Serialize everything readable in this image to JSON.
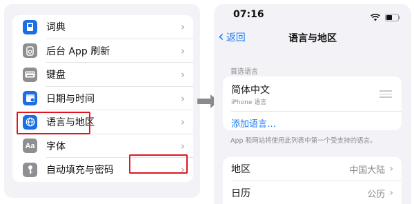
{
  "left_menu": {
    "items": [
      {
        "label": "词典",
        "icon": "book-icon"
      },
      {
        "label": "后台 App 刷新",
        "icon": "refresh-icon"
      },
      {
        "label": "键盘",
        "icon": "keyboard-icon"
      },
      {
        "label": "日期与时间",
        "icon": "calendar-clock-icon"
      },
      {
        "label": "语言与地区",
        "icon": "globe-icon"
      },
      {
        "label": "字体",
        "icon": "font-icon"
      },
      {
        "label": "自动填充与密码",
        "icon": "key-icon"
      }
    ]
  },
  "status_bar": {
    "time": "07:16"
  },
  "nav": {
    "back_label": "返回",
    "title": "语言与地区"
  },
  "preferred_languages": {
    "section_label": "首选语言",
    "language_name": "简体中文",
    "language_subtitle": "iPhone 语言",
    "add_language": "添加语言…"
  },
  "footnote": "App 和网站将使用此列表中第一个受支持的语言。",
  "region_settings": {
    "region_label": "地区",
    "region_value": "中国大陆",
    "calendar_label": "日历",
    "calendar_value": "公历"
  },
  "colors": {
    "accent": "#1a7cf5",
    "highlight": "#e0141e",
    "icon_blue": "#1a6fe6",
    "icon_gray": "#8e8e93"
  }
}
